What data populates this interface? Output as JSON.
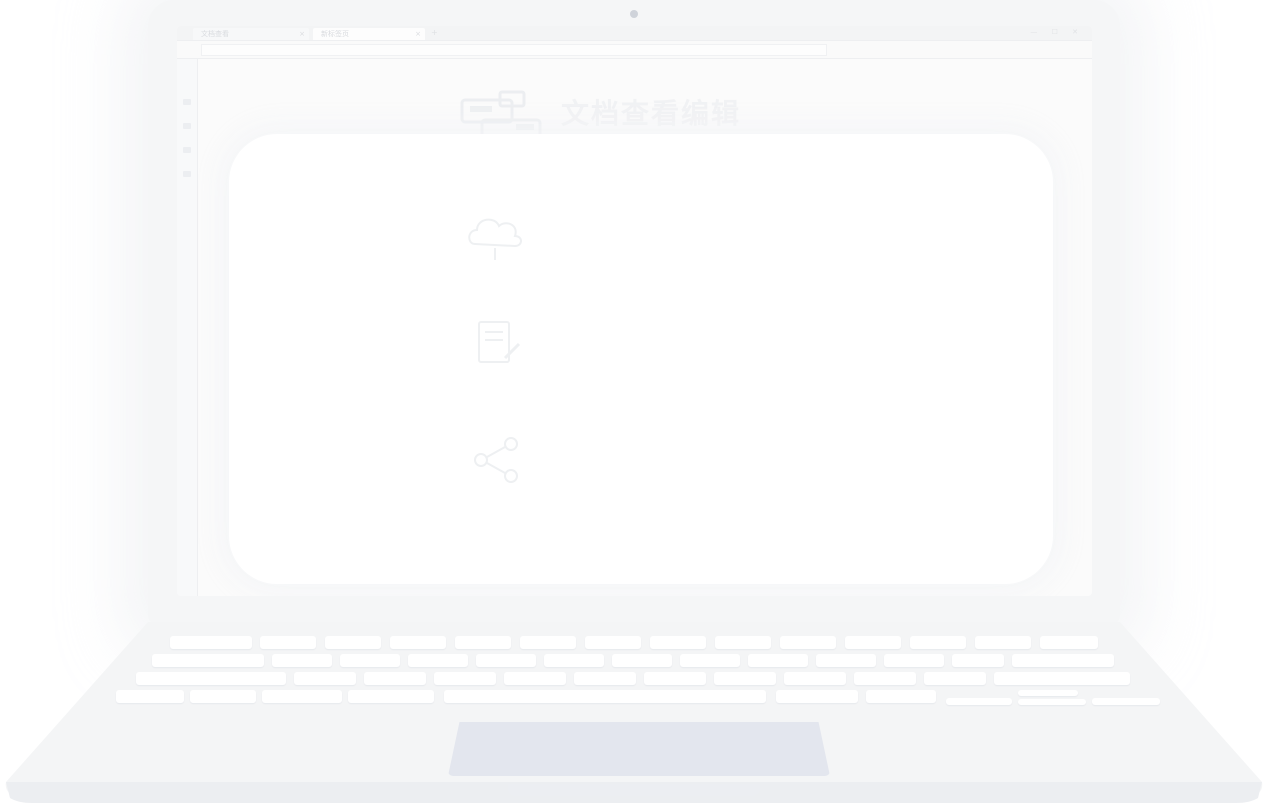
{
  "browser": {
    "tabs": [
      {
        "label": "文档查看",
        "close": "×"
      },
      {
        "label": "新标签页",
        "close": "×"
      }
    ],
    "new_tab": "+",
    "window_controls": "— ☐ ✕",
    "address_placeholder": ""
  },
  "hero": {
    "icon": "document-monitor-icon",
    "title": "文档查看编辑",
    "subtitle": ""
  },
  "features": [
    {
      "icon": "cloud-upload-icon",
      "title": "",
      "desc": ""
    },
    {
      "icon": "document-edit-icon",
      "title": "",
      "desc": ""
    },
    {
      "icon": "share-link-icon",
      "title": "",
      "desc": ""
    }
  ],
  "colors": {
    "lid": "#f5f6f7",
    "screen": "#fbfbfb",
    "panel": "#ffffff",
    "touchpad": "#e3e6ee",
    "faded_text": "#f1f2f4"
  }
}
